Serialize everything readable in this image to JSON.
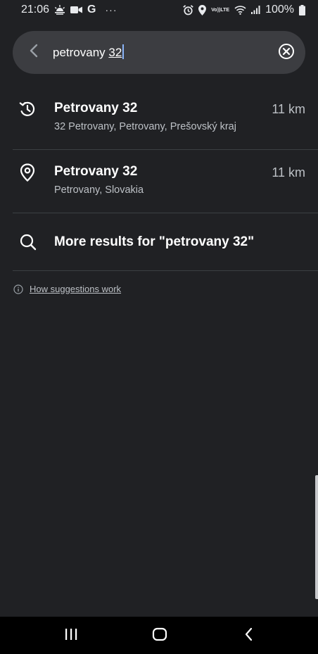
{
  "status_bar": {
    "time": "21:06",
    "g_label": "G",
    "more_dots": "···",
    "lte_top": "Vo))",
    "lte_bottom": "LTE",
    "battery": "100%"
  },
  "search": {
    "query_prefix": "petrovany ",
    "query_underlined": "32"
  },
  "results": [
    {
      "icon": "history-icon",
      "title": "Petrovany 32",
      "subtitle": "32 Petrovany, Petrovany, Prešovský kraj",
      "distance": "11 km"
    },
    {
      "icon": "place-pin-icon",
      "title": "Petrovany 32",
      "subtitle": "Petrovany, Slovakia",
      "distance": "11 km"
    }
  ],
  "more_results": {
    "icon": "search-icon",
    "label": "More results for \"petrovany 32\""
  },
  "suggestions": {
    "icon": "info-icon",
    "link": "How suggestions work"
  },
  "colors": {
    "background": "#202124",
    "search_bg": "#3c3d41",
    "cursor": "#8ab4f8",
    "secondary_text": "#bdc1c6"
  }
}
